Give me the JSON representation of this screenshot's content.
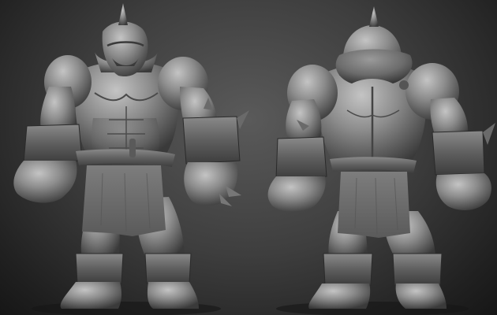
{
  "scene": {
    "kind": "3d-sculpt-render",
    "material": "clay",
    "background_color": "#3c3c3c",
    "clay_color": "#8a8a8a",
    "clay_highlight": "#bdbdbd",
    "clay_shadow": "#2e2e2e"
  },
  "views": [
    {
      "id": "front",
      "icon": "orc-front-view"
    },
    {
      "id": "back",
      "icon": "orc-back-view"
    }
  ]
}
